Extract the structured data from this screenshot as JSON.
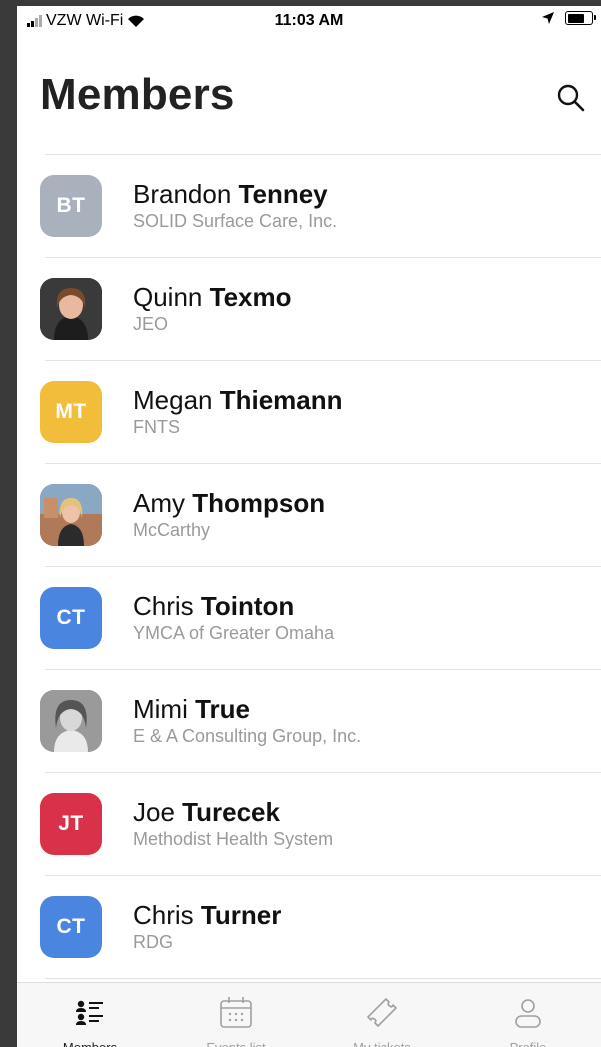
{
  "status_bar": {
    "carrier": "VZW Wi-Fi",
    "time": "11:03 AM"
  },
  "header": {
    "title": "Members"
  },
  "members": [
    {
      "first": "Brandon",
      "last": "Tenney",
      "company": "SOLID Surface Care, Inc.",
      "initials": "BT",
      "color": "#a9b1bd",
      "photo": false
    },
    {
      "first": "Quinn",
      "last": "Texmo",
      "company": "JEO",
      "initials": "",
      "color": "#3b3b3b",
      "photo": true
    },
    {
      "first": "Megan",
      "last": "Thiemann",
      "company": "FNTS",
      "initials": "MT",
      "color": "#f2bd3a",
      "photo": false
    },
    {
      "first": "Amy",
      "last": "Thompson",
      "company": "McCarthy",
      "initials": "",
      "color": "#7d94aa",
      "photo": true
    },
    {
      "first": "Chris",
      "last": "Tointon",
      "company": "YMCA of Greater Omaha",
      "initials": "CT",
      "color": "#4a86e0",
      "photo": false
    },
    {
      "first": "Mimi",
      "last": "True",
      "company": "E & A Consulting Group, Inc.",
      "initials": "",
      "color": "#8a8a8a",
      "photo": true
    },
    {
      "first": "Joe",
      "last": "Turecek",
      "company": "Methodist Health System",
      "initials": "JT",
      "color": "#d9314a",
      "photo": false
    },
    {
      "first": "Chris",
      "last": "Turner",
      "company": "RDG",
      "initials": "CT",
      "color": "#4a86e0",
      "photo": false
    }
  ],
  "tabs": [
    {
      "label": "Members",
      "icon": "members-icon",
      "active": true
    },
    {
      "label": "Events list",
      "icon": "calendar-icon",
      "active": false
    },
    {
      "label": "My tickets",
      "icon": "ticket-icon",
      "active": false
    },
    {
      "label": "Profile",
      "icon": "person-icon",
      "active": false
    }
  ]
}
